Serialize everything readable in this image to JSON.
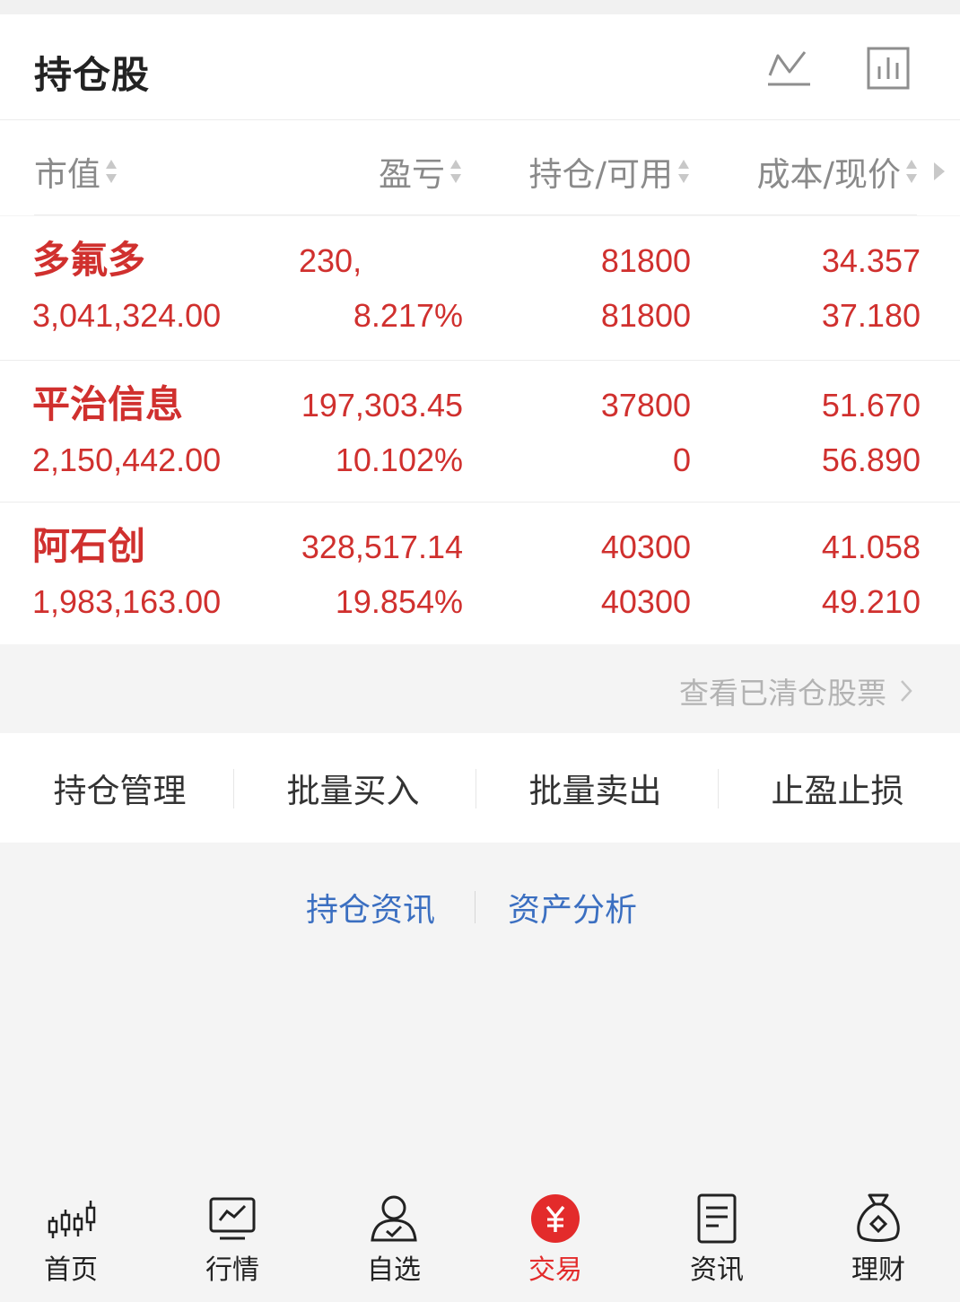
{
  "header": {
    "title": "持仓股",
    "icons": [
      "trend-line-icon",
      "bar-chart-icon"
    ]
  },
  "columns": {
    "market_value": "市值",
    "profit_loss": "盈亏",
    "position_available": "持仓/可用",
    "cost_price": "成本/现价"
  },
  "holdings": [
    {
      "name": "多氟多",
      "market_value": "3,041,324.00",
      "profit": "230,",
      "profit_pct": "8.217%",
      "position": "81800",
      "available": "81800",
      "cost": "34.357",
      "price": "37.180"
    },
    {
      "name": "平治信息",
      "market_value": "2,150,442.00",
      "profit": "197,303.45",
      "profit_pct": "10.102%",
      "position": "37800",
      "available": "0",
      "cost": "51.670",
      "price": "56.890"
    },
    {
      "name": "阿石创",
      "market_value": "1,983,163.00",
      "profit": "328,517.14",
      "profit_pct": "19.854%",
      "position": "40300",
      "available": "40300",
      "cost": "41.058",
      "price": "49.210"
    }
  ],
  "cleared_link": "查看已清仓股票",
  "actions": [
    "持仓管理",
    "批量买入",
    "批量卖出",
    "止盈止损"
  ],
  "links": [
    "持仓资讯",
    "资产分析"
  ],
  "tabbar": [
    {
      "label": "首页",
      "icon": "candlestick-icon",
      "active": false
    },
    {
      "label": "行情",
      "icon": "market-chart-icon",
      "active": false
    },
    {
      "label": "自选",
      "icon": "user-check-icon",
      "active": false
    },
    {
      "label": "交易",
      "icon": "yen-icon",
      "active": true
    },
    {
      "label": "资讯",
      "icon": "document-icon",
      "active": false
    },
    {
      "label": "理财",
      "icon": "money-bag-icon",
      "active": false
    }
  ],
  "colors": {
    "accent_red": "#d0302e",
    "active_tab_red": "#e32b2b",
    "link_blue": "#3b6fc1"
  }
}
